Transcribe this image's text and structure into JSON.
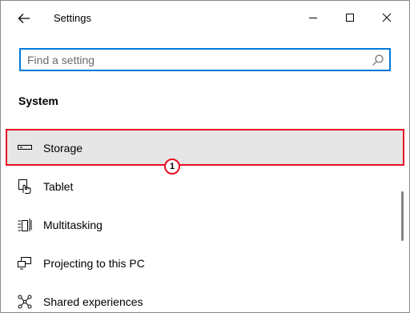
{
  "window": {
    "title": "Settings"
  },
  "titlebar": {
    "back_icon": "arrow-left-icon",
    "minimize_icon": "minimize-icon",
    "maximize_icon": "maximize-icon",
    "close_icon": "close-icon"
  },
  "search": {
    "placeholder": "Find a setting",
    "value": "",
    "icon": "search-icon",
    "border_color": "#0078d7"
  },
  "section": {
    "title": "System"
  },
  "items": [
    {
      "label": "Storage",
      "icon": "storage-icon",
      "selected": true
    },
    {
      "label": "Tablet",
      "icon": "tablet-icon",
      "selected": false
    },
    {
      "label": "Multitasking",
      "icon": "multitasking-icon",
      "selected": false
    },
    {
      "label": "Projecting to this PC",
      "icon": "projecting-icon",
      "selected": false
    },
    {
      "label": "Shared experiences",
      "icon": "shared-experiences-icon",
      "selected": false
    }
  ],
  "annotation": {
    "number": "1",
    "color": "#e81123"
  },
  "colors": {
    "selected_bg": "#e6e6e6",
    "highlight": "#e81123",
    "accent": "#0078d7"
  }
}
